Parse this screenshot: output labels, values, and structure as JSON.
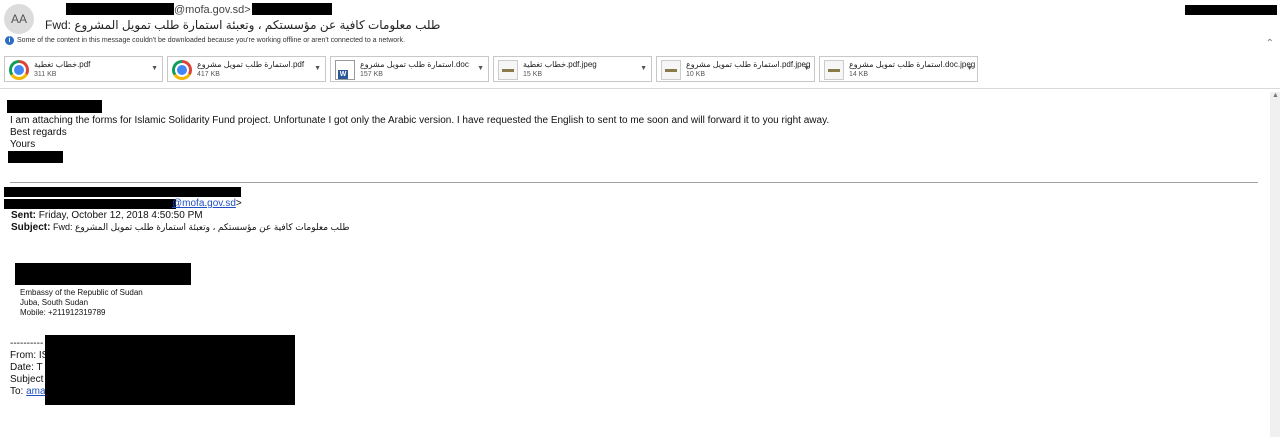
{
  "header": {
    "avatar_initials": "AA",
    "from_domain": "@mofa.gov.sd>",
    "subject": "Fwd: طلب معلومات كافية عن مؤسستكم ، وتعبئة استمارة طلب تمويل المشروع",
    "info_message": "Some of the content in this message couldn't be downloaded because you're working offline or aren't connected to a network."
  },
  "attachments": [
    {
      "name": "خطاب تغطية.pdf",
      "size": "311 KB",
      "icon": "chrome-icon"
    },
    {
      "name": "استمارة طلب تمويل مشروع.pdf",
      "size": "417 KB",
      "icon": "chrome-icon"
    },
    {
      "name": "استمارة طلب تمويل مشروع.doc",
      "size": "157 KB",
      "icon": "word-icon"
    },
    {
      "name": "خطاب تغطية.pdf.jpeg",
      "size": "15 KB",
      "icon": "image-icon"
    },
    {
      "name": "استمارة طلب تمويل مشروع.pdf.jpeg",
      "size": "10 KB",
      "icon": "image-icon"
    },
    {
      "name": "استمارة طلب تمويل مشروع.doc.jpeg",
      "size": "14 KB",
      "icon": "image-icon"
    }
  ],
  "body": {
    "line1": "I am attaching the forms for Islamic Solidarity Fund project. Unfortunate I got only the Arabic version. I have requested the English to sent to me soon and  will forward it to you right away.",
    "line2": "Best regards",
    "line3": "Yours"
  },
  "forwarded": {
    "email_domain": "@mofa.gov.sd",
    "email_suffix": ">",
    "sent_label": "Sent:",
    "sent_value": " Friday, October 12, 2018 4:50:50 PM",
    "subject_label": "Subject:",
    "subject_value": " Fwd: طلب معلومات كافية عن مؤسستكم ، وتعبئة استمارة طلب تمويل المشروع"
  },
  "signature": {
    "line1": "Embassy of the Republic of Sudan",
    "line2": "Juba, South Sudan",
    "line3": "Mobile: +211912319789"
  },
  "nested": {
    "dashes": "----------",
    "from_prefix": "From: IS",
    "date_prefix": "Date: T",
    "subject_prefix": "Subject",
    "to_label": "To: ",
    "to_link": "ama"
  }
}
